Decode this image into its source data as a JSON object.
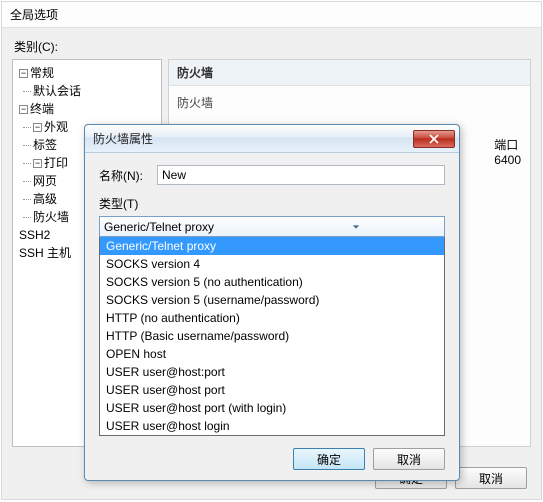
{
  "window": {
    "title": "全局选项"
  },
  "cat_label": "类别(C):",
  "tree": {
    "n0": "常规",
    "n0_0": "默认会话",
    "n1": "终端",
    "n1_0": "外观",
    "n1_1": "标签",
    "n1_2": "打印",
    "n1_3": "网页",
    "n1_4": "高级",
    "n1_5": "防火墙",
    "n2": "SSH2",
    "n3": "SSH 主机"
  },
  "panel": {
    "title": "防火墙",
    "sub": "防火墙",
    "port_label": "端口",
    "port_value": "6400"
  },
  "bottom": {
    "ok": "确定",
    "cancel": "取消"
  },
  "modal": {
    "title": "防火墙属性",
    "name_label": "名称(N):",
    "name_value": "New",
    "type_label": "类型(T)",
    "type_selected": "Generic/Telnet proxy",
    "options": [
      "Generic/Telnet proxy",
      "SOCKS version 4",
      "SOCKS version 5 (no authentication)",
      "SOCKS version 5 (username/password)",
      "HTTP (no authentication)",
      "HTTP (Basic username/password)",
      "OPEN host",
      "USER user@host:port",
      "USER user@host port",
      "USER user@host port (with login)",
      "USER user@host login"
    ],
    "ok": "确定",
    "cancel": "取消"
  }
}
